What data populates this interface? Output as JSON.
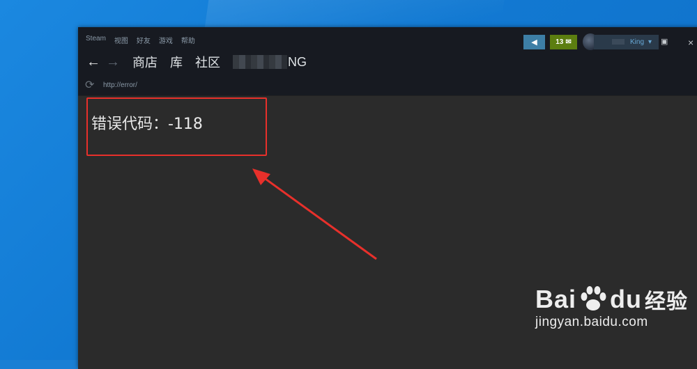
{
  "menu": [
    "Steam",
    "视图",
    "好友",
    "游戏",
    "帮助"
  ],
  "nav": {
    "back_icon": "back-arrow-icon",
    "forward_icon": "forward-arrow-icon",
    "links": [
      "商店",
      "库",
      "社区"
    ],
    "profile_tail": "NG"
  },
  "url": {
    "text": "http://error/"
  },
  "toolbar": {
    "message_count": "13",
    "user_name": "King"
  },
  "content": {
    "error_text": "错误代码：-118"
  },
  "annotation": {
    "color": "#e8302b"
  },
  "watermark": {
    "brand_prefix": "Bai",
    "brand_suffix": "du",
    "brand_cn": "经验",
    "url": "jingyan.baidu.com"
  }
}
